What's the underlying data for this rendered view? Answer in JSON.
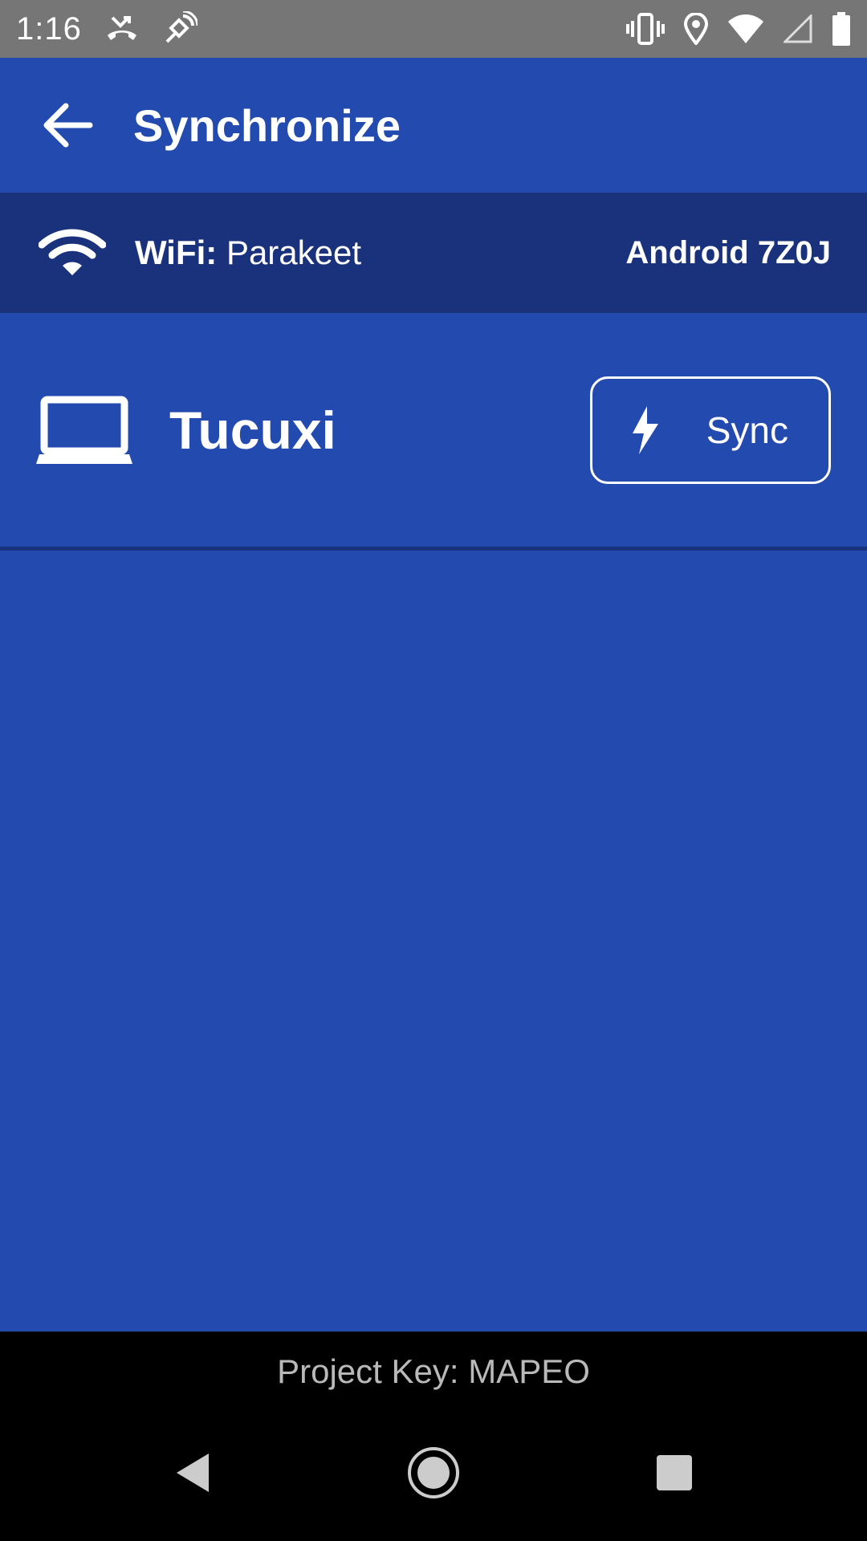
{
  "status_bar": {
    "time": "1:16",
    "icons_left": [
      "missed-call-icon",
      "satellite-icon"
    ],
    "icons_right": [
      "vibrate-icon",
      "location-icon",
      "wifi-signal-icon",
      "cell-signal-icon",
      "battery-icon"
    ]
  },
  "app_bar": {
    "title": "Synchronize",
    "back_icon": "arrow-back-icon"
  },
  "connection": {
    "wifi_label": "WiFi:",
    "wifi_network": "Parakeet",
    "device_name": "Android 7Z0J",
    "wifi_icon": "wifi-icon"
  },
  "peers": [
    {
      "name": "Tucuxi",
      "icon": "laptop-icon",
      "action_label": "Sync",
      "action_icon": "lightning-bolt-icon"
    }
  ],
  "footer": {
    "project_key": "Project Key: MAPEO"
  },
  "navigation": {
    "buttons": [
      "back-nav-icon",
      "home-nav-icon",
      "recents-nav-icon"
    ]
  },
  "colors": {
    "primary": "#234aaf",
    "primary_dark": "#1a327c",
    "status_bar": "#767676",
    "footer": "#000000",
    "footer_text": "#b9b9b9"
  }
}
